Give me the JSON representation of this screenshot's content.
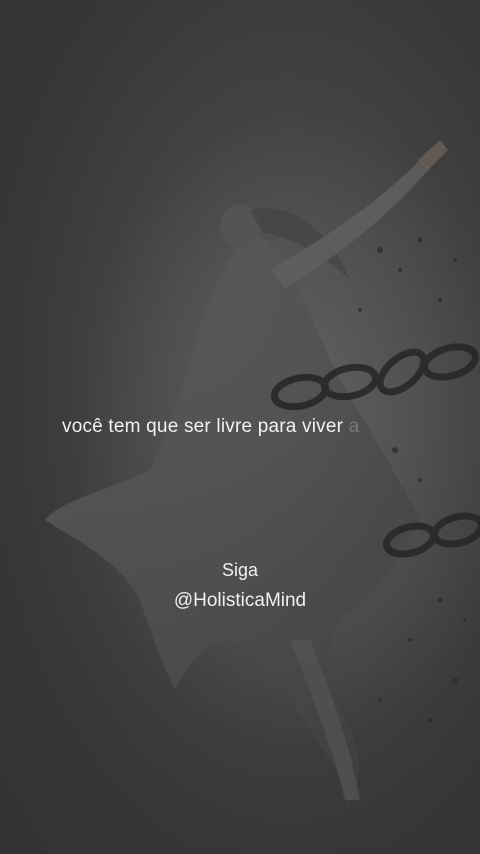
{
  "caption": {
    "text": "você tem que ser livre para viver",
    "faded_text": "a"
  },
  "follow": {
    "siga": "Siga",
    "handle": "@HolisticaMind"
  },
  "colors": {
    "background": "#3f3f3f",
    "text": "#f2f2f2"
  }
}
